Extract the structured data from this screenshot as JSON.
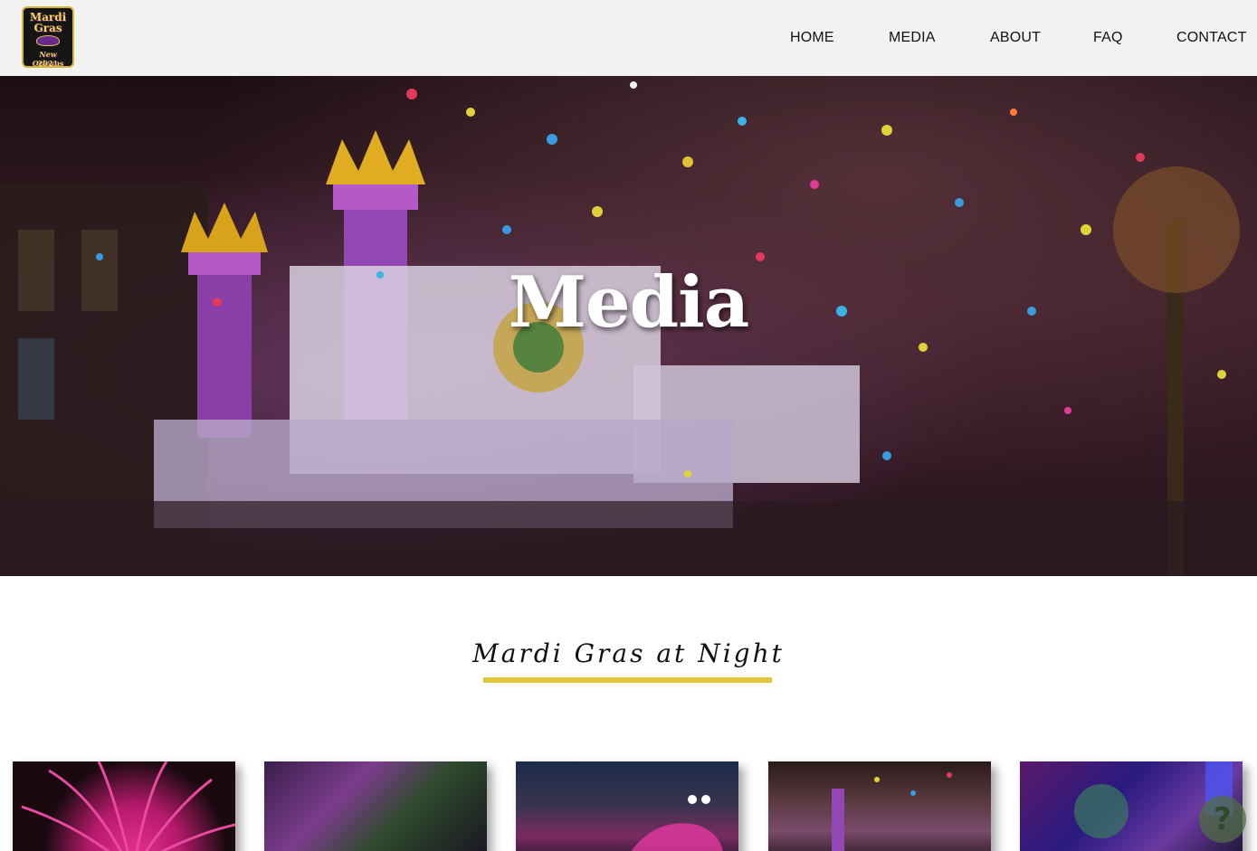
{
  "header": {
    "logo": {
      "line1": "Mardi",
      "line2": "Gras",
      "line3": "New Orleans",
      "line4": "2021"
    },
    "nav": [
      {
        "label": "HOME"
      },
      {
        "label": "MEDIA"
      },
      {
        "label": "ABOUT"
      },
      {
        "label": "FAQ"
      },
      {
        "label": "CONTACT"
      }
    ]
  },
  "hero": {
    "title": "Media"
  },
  "section": {
    "title": "Mardi Gras at Night"
  },
  "gallery": {
    "thumbnails": [
      {
        "name": "feather-costume"
      },
      {
        "name": "parade-crowd"
      },
      {
        "name": "dragon-float"
      },
      {
        "name": "castle-float-confetti"
      },
      {
        "name": "neon-float"
      }
    ]
  },
  "help": {
    "icon": "question-icon",
    "glyph": "?"
  },
  "colors": {
    "header_bg": "#f2f2f2",
    "accent_underline": "#e2c43b",
    "hero_title": "#ffffff"
  }
}
